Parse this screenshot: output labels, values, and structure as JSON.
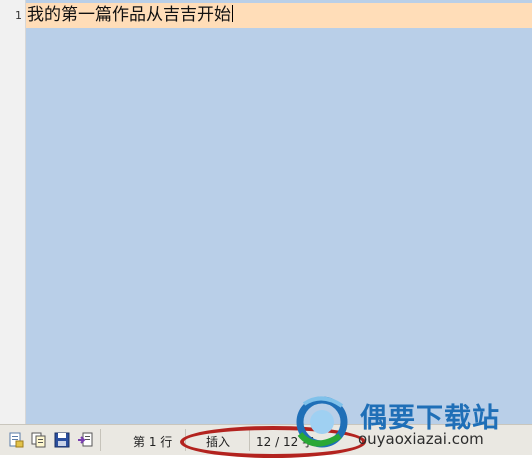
{
  "editor": {
    "line_number": "1",
    "line_text": "我的第一篇作品从吉吉开始"
  },
  "toolbar": {
    "icons": [
      "new-document-icon",
      "copy-icon",
      "save-icon",
      "import-icon"
    ]
  },
  "status": {
    "line": "第 1 行",
    "mode": "插入",
    "chars": "12 / 12 字"
  },
  "watermark": {
    "name": "偶要下载站",
    "url": "ouyaoxiazai.com"
  },
  "colors": {
    "editor_background": "#b9cfe8",
    "current_line": "#ffddb8",
    "highlight": "#b3231f",
    "watermark_blue": "#1f6fb7"
  }
}
